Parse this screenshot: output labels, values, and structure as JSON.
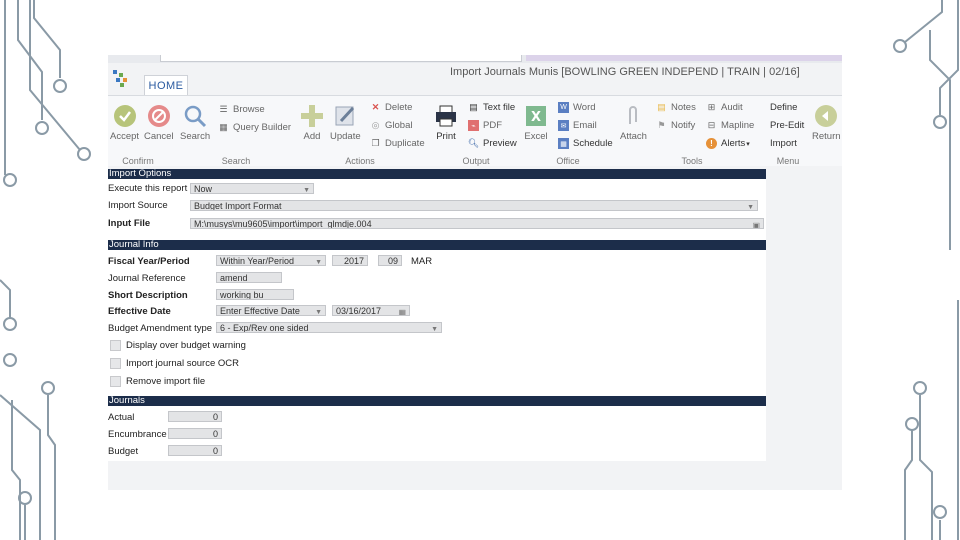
{
  "window": {
    "home_tab": "HOME",
    "title": "Import Journals   Munis [BOWLING GREEN INDEPEND | TRAIN | 02/16]"
  },
  "ribbon": {
    "groups": {
      "confirm": "Confirm",
      "search": "Search",
      "actions": "Actions",
      "output": "Output",
      "office": "Office",
      "tools": "Tools",
      "menu": "Menu"
    },
    "accept": "Accept",
    "cancel": "Cancel",
    "search": "Search",
    "browse": "Browse",
    "query_builder": "Query Builder",
    "add": "Add",
    "update": "Update",
    "delete": "Delete",
    "global": "Global",
    "duplicate": "Duplicate",
    "print": "Print",
    "text_file": "Text file",
    "pdf": "PDF",
    "preview": "Preview",
    "excel": "Excel",
    "word": "Word",
    "email": "Email",
    "schedule": "Schedule",
    "attach": "Attach",
    "notes": "Notes",
    "notify": "Notify",
    "audit": "Audit",
    "mapline": "Mapline",
    "alerts": "Alerts",
    "define": "Define",
    "pre_edit": "Pre-Edit",
    "import": "Import",
    "return": "Return"
  },
  "import_options": {
    "header": "Import Options",
    "execute_label": "Execute this report",
    "execute_value": "Now",
    "source_label": "Import Source",
    "source_value": "Budget Import Format",
    "file_label": "Input File",
    "file_value": "M:\\musys\\mu9605\\import\\import_glmdje.004"
  },
  "journal_info": {
    "header": "Journal Info",
    "fiscal_label": "Fiscal Year/Period",
    "fiscal_mode": "Within Year/Period",
    "fiscal_year": "2017",
    "fiscal_period": "09",
    "fiscal_month": "MAR",
    "reference_label": "Journal Reference",
    "reference_value": "amend",
    "short_desc_label": "Short Description",
    "short_desc_value": "working bu",
    "eff_date_label": "Effective Date",
    "eff_date_mode": "Enter Effective Date",
    "eff_date_value": "03/16/2017",
    "amend_type_label": "Budget Amendment type",
    "amend_type_value": "6 - Exp/Rev one sided",
    "check_warning": "Display over budget warning",
    "check_ocr": "Import journal source OCR",
    "check_remove": "Remove import file"
  },
  "journals": {
    "header": "Journals",
    "actual_label": "Actual",
    "actual_value": "0",
    "encumbrance_label": "Encumbrance",
    "encumbrance_value": "0",
    "budget_label": "Budget",
    "budget_value": "0"
  },
  "colors": {
    "section_header": "#1c2d4a",
    "circuit": "#8a9aa6",
    "accent_blue": "#2a5aa0"
  }
}
